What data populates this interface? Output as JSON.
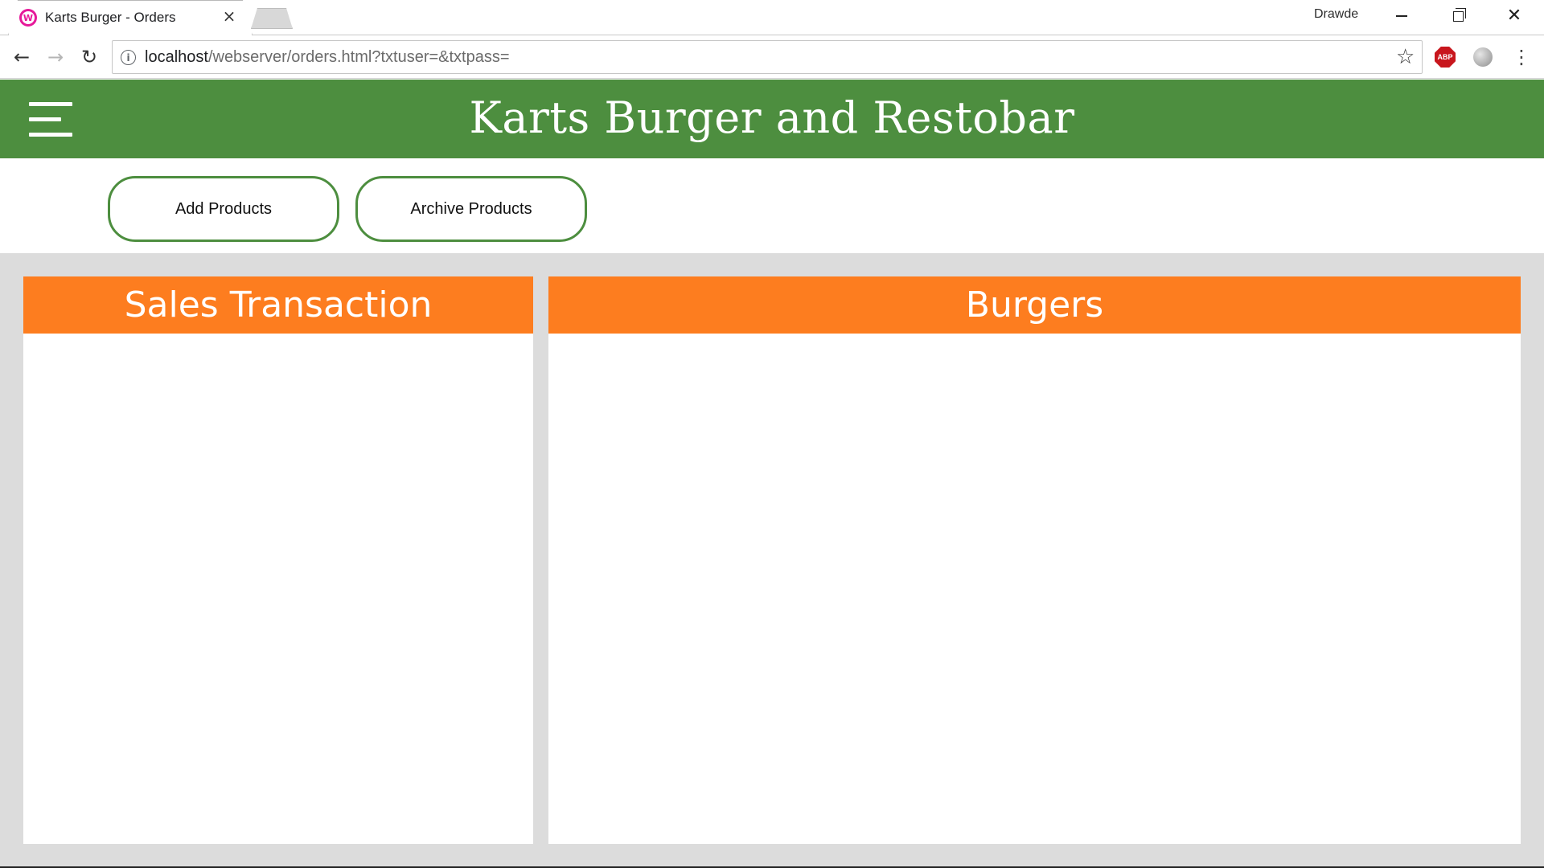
{
  "browser": {
    "tab_title": "Karts Burger - Orders",
    "tab_close": "×",
    "favicon_letter": "W",
    "profile_name": "Drawde",
    "url_host": "localhost",
    "url_path": "/webserver/orders.html?txtuser=&txtpass=",
    "info_glyph": "i",
    "star_glyph": "☆",
    "abp_label": "ABP",
    "back_glyph": "←",
    "forward_glyph": "→",
    "reload_glyph": "↻",
    "menu_glyph": "⋮",
    "close_glyph": "✕"
  },
  "header": {
    "title": "Karts Burger and Restobar"
  },
  "actions": {
    "add_products": "Add Products",
    "archive_products": "Archive Products"
  },
  "panels": {
    "sales_title": "Sales Transaction",
    "burgers_title": "Burgers"
  },
  "colors": {
    "header_green": "#4d8e3f",
    "panel_orange": "#fd7d1f",
    "workspace_gray": "#dcdcdc"
  }
}
